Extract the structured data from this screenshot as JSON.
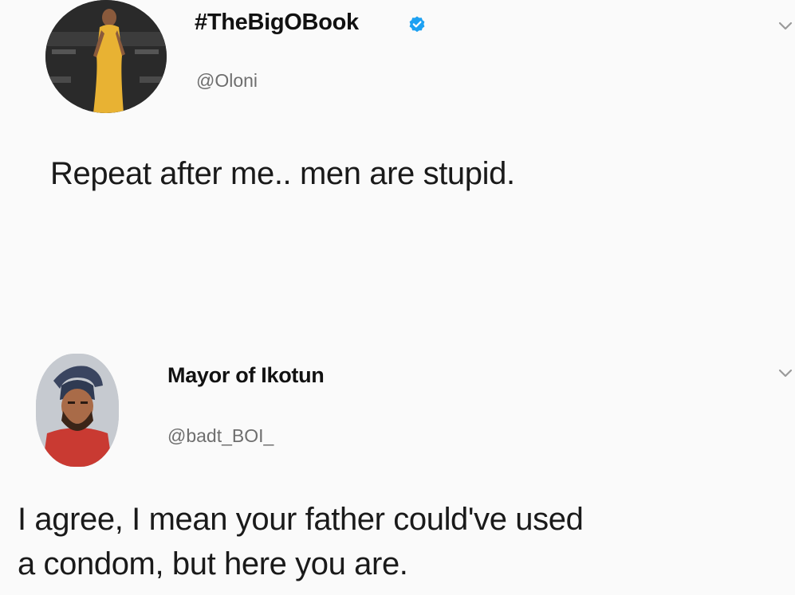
{
  "tweets": [
    {
      "display_name": "#TheBigOBook",
      "handle": "@Oloni",
      "verified": true,
      "text": "Repeat after me.. men are stupid.",
      "avatar": "woman-in-yellow-dress-photo"
    },
    {
      "display_name": "Mayor of Ikotun",
      "handle": "@badt_BOI_",
      "verified": false,
      "text_lines": [
        "I agree, I mean your father could've used",
        "a condom, but here you are."
      ],
      "avatar": "man-in-cap-and-red-shirt-photo"
    }
  ],
  "colors": {
    "background": "#fafafa",
    "text": "#1a1a1a",
    "handle": "#6e6e6e",
    "verified": "#1da1f2"
  },
  "icons": [
    "verified-badge-icon",
    "chevron-down-icon"
  ]
}
